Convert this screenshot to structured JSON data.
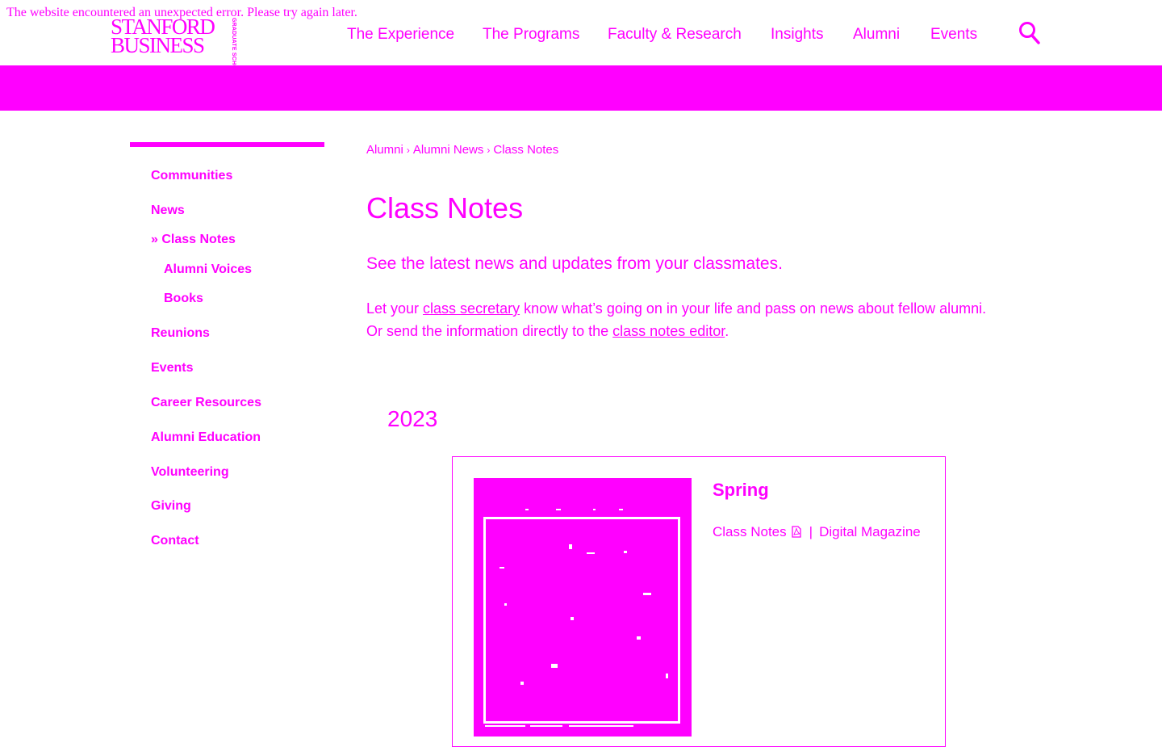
{
  "error_message": "The website encountered an unexpected error. Please try again later.",
  "logo": {
    "line1": "STANFORD",
    "line2": "BUSINESS",
    "side_text": "GRADUATE SCHOOL OF"
  },
  "topnav": [
    {
      "label": "The Experience"
    },
    {
      "label": "The Programs"
    },
    {
      "label": "Faculty & Research"
    },
    {
      "label": "Insights"
    },
    {
      "label": "Alumni"
    },
    {
      "label": "Events"
    }
  ],
  "search_icon": "search-icon",
  "sidebar": {
    "items": [
      {
        "label": "Communities"
      },
      {
        "label": "News"
      },
      {
        "label": "Class Notes",
        "active": true,
        "marker": "»"
      },
      {
        "label": "Alumni Voices"
      },
      {
        "label": "Books"
      },
      {
        "label": "Reunions"
      },
      {
        "label": "Events"
      },
      {
        "label": "Career Resources"
      },
      {
        "label": "Alumni Education"
      },
      {
        "label": "Volunteering"
      },
      {
        "label": "Giving"
      },
      {
        "label": "Contact"
      }
    ]
  },
  "breadcrumb": {
    "items": [
      "Alumni",
      "Alumni News",
      "Class Notes"
    ],
    "separator": "›"
  },
  "page_title": "Class Notes",
  "lede": "See the latest news and updates from your classmates.",
  "body": {
    "part1": "Let your ",
    "link1": "class secretary",
    "part2": " know what’s going on in your life and pass on news about fellow alumni. Or send the information directly to the ",
    "link2": "class notes editor",
    "part3": "."
  },
  "year": "2023",
  "issue": {
    "season": "Spring",
    "class_notes_link": "Class Notes",
    "pdf_icon": "pdf-file-icon",
    "separator": "|",
    "digital_magazine_link": "Digital Magazine"
  },
  "colors": {
    "accent": "#ff00ff",
    "background": "#ffffff"
  }
}
